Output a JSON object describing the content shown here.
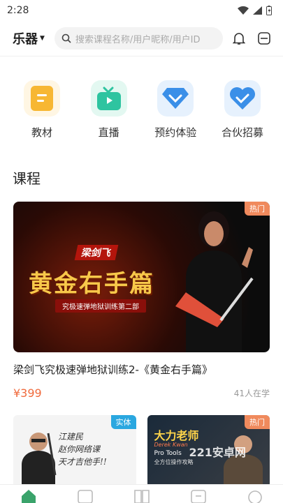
{
  "status": {
    "time": "2:28"
  },
  "header": {
    "category": "乐器",
    "search_placeholder": "搜索课程名称/用户昵称/用户ID"
  },
  "quick_nav": [
    {
      "label": "教材",
      "icon": "book-icon",
      "color": "#f7b733"
    },
    {
      "label": "直播",
      "icon": "live-tv-icon",
      "color": "#2ec4a0"
    },
    {
      "label": "预约体验",
      "icon": "diamond-icon",
      "color": "#3a8fe8"
    },
    {
      "label": "合伙招募",
      "icon": "heart-icon",
      "color": "#3a8fe8"
    }
  ],
  "section": {
    "title": "课程"
  },
  "featured": {
    "badge": "热门",
    "thumb_tag": "梁剑飞",
    "thumb_title": "黄金右手篇",
    "thumb_sub": "究极速弹地狱训练第二部",
    "title": "梁剑飞究极速弹地狱训练2-《黄金右手篇》",
    "price": "¥399",
    "learners": "41人在学"
  },
  "cards": [
    {
      "badge": "实体",
      "badge_color": "#2aa7e0",
      "line1": "江建民",
      "line2": "赵你网络课",
      "line3": "天才吉他手!!"
    },
    {
      "badge": "热门",
      "badge_color": "#f08a5d",
      "line1": "大力老师",
      "line2": "Derek Kwan",
      "line3": "Pro Tools",
      "line4": "全方位操作攻略",
      "watermark": "221安卓网"
    }
  ],
  "colors": {
    "accent": "#f06a3c",
    "primary_green": "#3aa36b"
  }
}
